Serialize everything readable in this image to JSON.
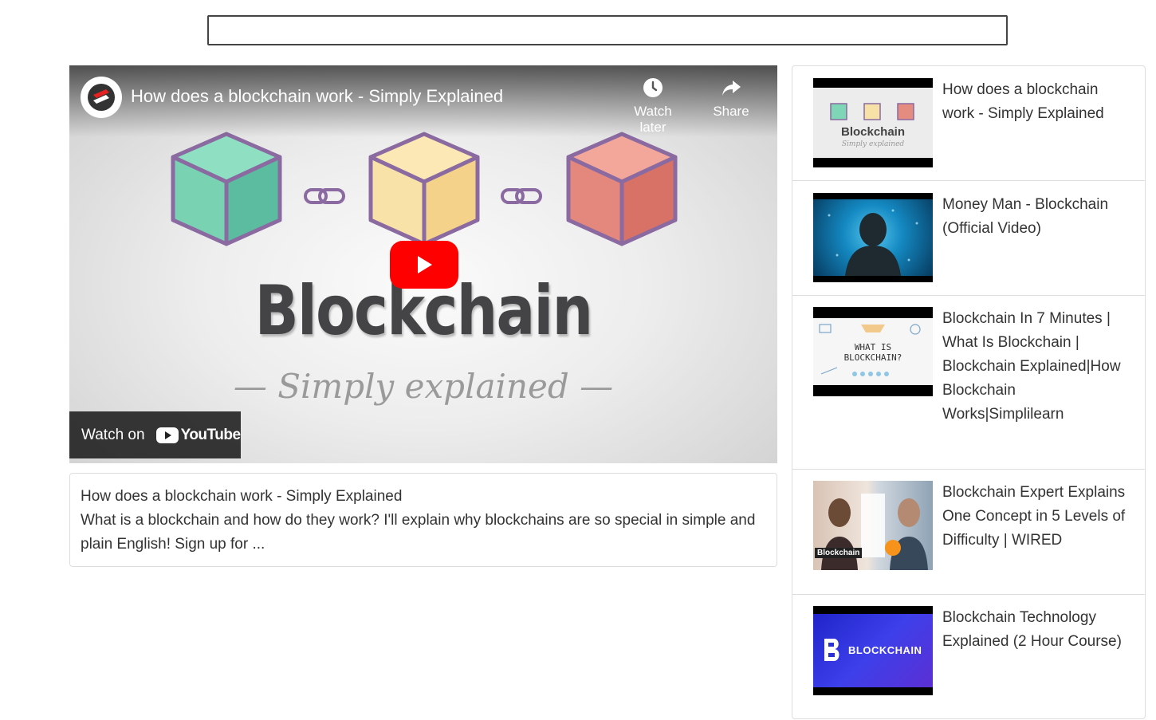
{
  "search": {
    "value": "",
    "placeholder": ""
  },
  "player": {
    "title": "How does a blockchain work - Simply Explained",
    "watch_later_label": "Watch later",
    "share_label": "Share",
    "watch_on_label": "Watch on",
    "youtube_label": "YouTube",
    "thumbnail_heading": "Blockchain",
    "thumbnail_subheading": "— Simply explained —",
    "play_color": "#ff0000"
  },
  "description": {
    "title": "How does a blockchain work - Simply Explained",
    "text": "What is a blockchain and how do they work? I'll explain why blockchains are so special in simple and plain English! Sign up for ..."
  },
  "related": [
    {
      "title": "How does a blockchain work - Simply Explained",
      "thumb_text": "Blockchain",
      "thumb_sub": "Simply explained",
      "thumb_color": "#e9e9e9"
    },
    {
      "title": "Money Man - Blockchain (Official Video)",
      "thumb_color": "#0d5f8f"
    },
    {
      "title": "Blockchain In 7 Minutes | What Is Blockchain | Blockchain Explained|How Blockchain Works|Simplilearn",
      "thumb_text": "WHAT IS BLOCKCHAIN?",
      "thumb_color": "#f4f4f4"
    },
    {
      "title": "Blockchain Expert Explains One Concept in 5 Levels of Difficulty | WIRED",
      "thumb_text": "Blockchain",
      "thumb_color": "#2a2a2a"
    },
    {
      "title": "Blockchain Technology Explained (2 Hour Course)",
      "thumb_text": "BLOCKCHAIN",
      "thumb_color": "#2b2fd6"
    }
  ]
}
